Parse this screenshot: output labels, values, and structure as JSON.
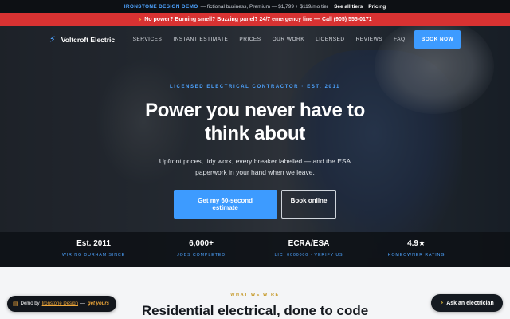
{
  "demo_bar": {
    "brand": "IRONSTONE DESIGN DEMO",
    "text": "— fictional business, Premium — $1,799 + $119/mo tier",
    "see_all": "See all tiers",
    "pricing": "Pricing"
  },
  "emergency": {
    "icon": "bolt-icon",
    "text": "No power? Burning smell? Buzzing panel? 24/7 emergency line —",
    "phone": "Call (905) 555-0171"
  },
  "nav": {
    "logo_icon": "bolt-icon",
    "logo_text": "Voltcroft Electric",
    "links": [
      "SERVICES",
      "INSTANT ESTIMATE",
      "PRICES",
      "OUR WORK",
      "LICENSED",
      "REVIEWS",
      "FAQ"
    ],
    "book_button": "BOOK NOW"
  },
  "hero": {
    "eyebrow": "LICENSED ELECTRICAL CONTRACTOR · EST. 2011",
    "headline_line1": "Power you never have to",
    "headline_line2": "think about",
    "sub_line1": "Upfront prices, tidy work, every breaker labelled — and the ESA",
    "sub_line2": "paperwork in your hand when we leave.",
    "cta_primary": "Get my 60-second estimate",
    "cta_secondary": "Book online"
  },
  "stats": [
    {
      "value": "Est. 2011",
      "label": "WIRING DURHAM SINCE"
    },
    {
      "value": "6,000+",
      "label": "JOBS COMPLETED"
    },
    {
      "value": "ECRA/ESA",
      "label": "LIC. 0000000 · VERIFY US"
    },
    {
      "value": "4.9★",
      "label": "HOMEOWNER RATING"
    }
  ],
  "section": {
    "eyebrow": "WHAT WE WIRE",
    "title": "Residential electrical, done to code"
  },
  "demo_pill": {
    "icon": "document-icon",
    "prefix": "Demo by",
    "brand": "Ironstone Design",
    "sep": "—",
    "suffix": "get yours"
  },
  "ask_pill": {
    "icon": "bolt-icon",
    "label": "Ask an electrician"
  },
  "colors": {
    "accent": "#3d9bff",
    "emergency": "#d83232",
    "gold": "#c69a2a"
  }
}
